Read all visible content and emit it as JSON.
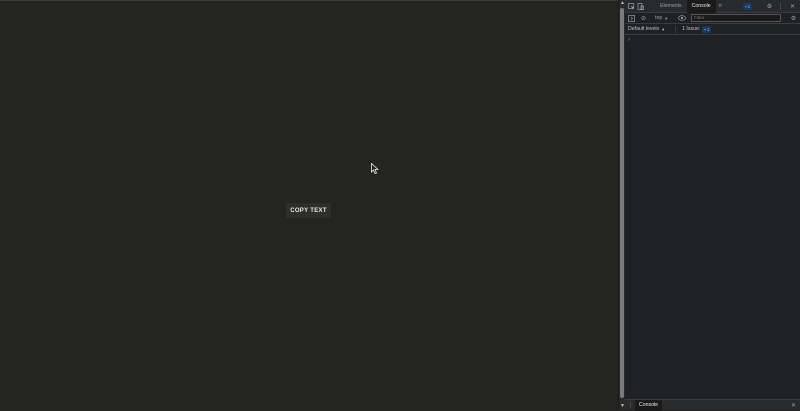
{
  "page": {
    "copy_button_label": "COPY TEXT"
  },
  "devtools": {
    "tabs": [
      "Elements",
      "Console"
    ],
    "more_tabs_icon": "chevron-double-right-icon",
    "issues_badge": "1",
    "context": "top",
    "filter_placeholder": "Filter",
    "levels": "Default levels",
    "issues_label": "1 Issue:",
    "issues_count": "1",
    "prompt": "›",
    "drawer_tab": "Console"
  },
  "colors": {
    "page_bg": "#242421",
    "devtools_bg": "#202124",
    "accent": "#8ab4f8"
  }
}
